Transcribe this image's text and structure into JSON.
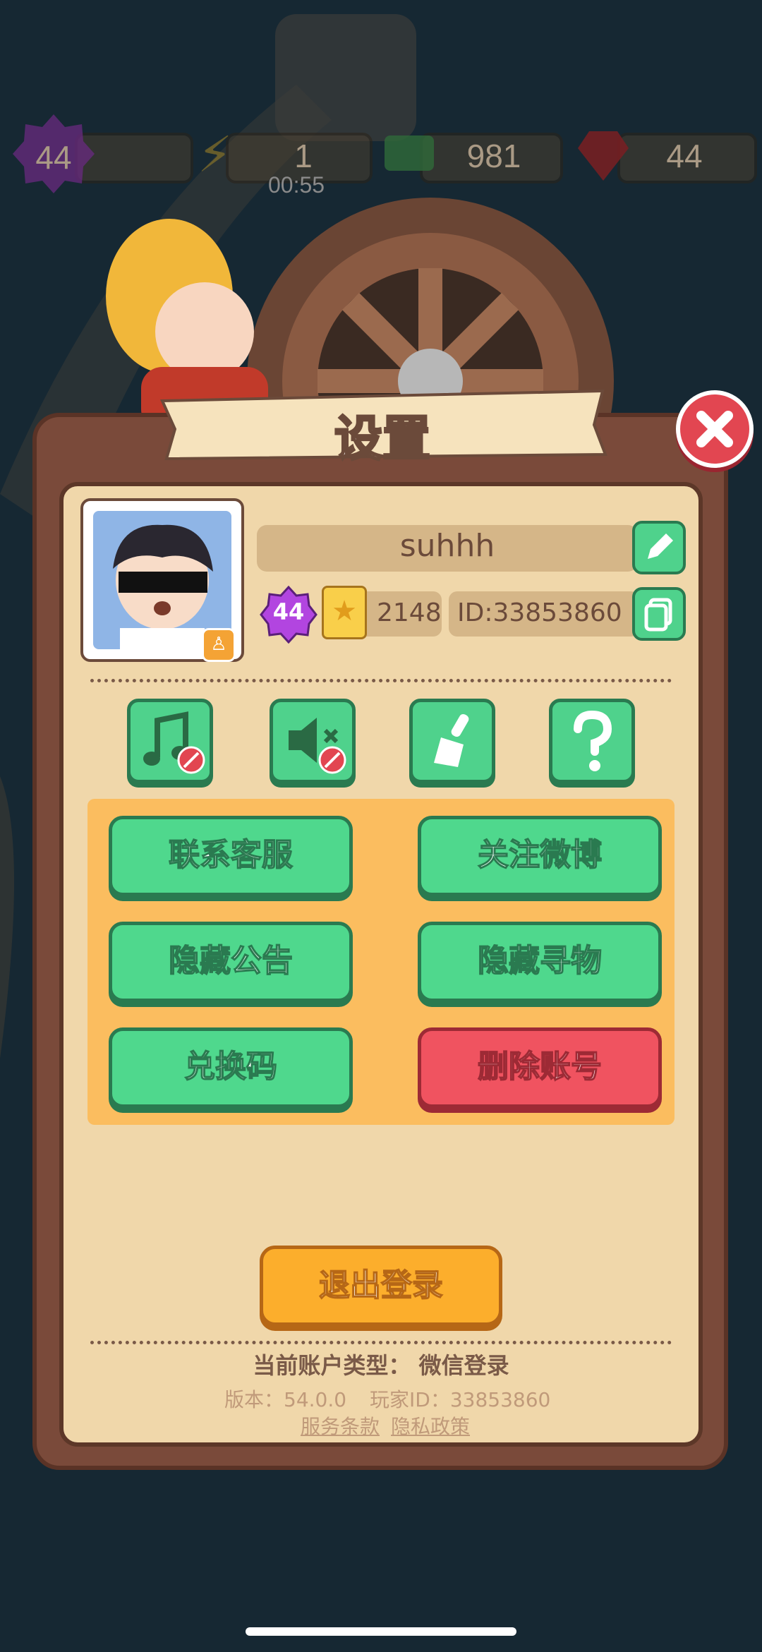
{
  "top_bar": {
    "level": "44",
    "energy": "1",
    "energy_timer": "00:55",
    "cash": "981",
    "gems": "44"
  },
  "dialog": {
    "title": "设置",
    "profile": {
      "name": "suhhh",
      "level": "44",
      "stars": "2148",
      "id_label": "ID:33853860"
    },
    "buttons": {
      "contact_support": "联系客服",
      "follow_weibo": "关注微博",
      "hide_notice": "隐藏公告",
      "hide_search": "隐藏寻物",
      "redeem_code": "兑换码",
      "delete_account": "删除账号",
      "logout": "退出登录"
    },
    "footer": {
      "account_type": "当前账户类型： 微信登录",
      "version": "版本：54.0.0",
      "player_id": "玩家ID：33853860",
      "terms_link": "服务条款",
      "privacy_link": "隐私政策"
    }
  },
  "colors": {
    "green_button": "#4fd88d",
    "red_button": "#f05360",
    "orange_button": "#fcae2c",
    "panel_bg": "#f0d7aa",
    "frame_brown": "#7a4a3a"
  },
  "icons": [
    "music-off-icon",
    "sound-off-icon",
    "broom-icon",
    "help-icon",
    "edit-icon",
    "copy-icon",
    "close-icon"
  ]
}
